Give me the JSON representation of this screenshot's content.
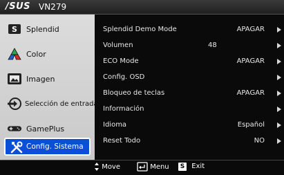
{
  "header": {
    "brand": "/SUS",
    "model": "VN279"
  },
  "sidebar": {
    "items": [
      {
        "label": "Splendid",
        "icon": "splendid-icon"
      },
      {
        "label": "Color",
        "icon": "color-icon"
      },
      {
        "label": "Imagen",
        "icon": "image-icon"
      },
      {
        "label": "Selección de entrada",
        "icon": "input-select-icon"
      },
      {
        "label": "GamePlus",
        "icon": "gameplus-icon"
      },
      {
        "label": "Config. Sistema",
        "icon": "system-setup-icon",
        "active": true
      }
    ]
  },
  "settings": [
    {
      "name": "Splendid Demo Mode",
      "value": "APAGAR"
    },
    {
      "name": "Volumen",
      "value": "48"
    },
    {
      "name": "ECO Mode",
      "value": "APAGAR"
    },
    {
      "name": "Config. OSD",
      "value": ""
    },
    {
      "name": "Bloqueo de teclas",
      "value": "APAGAR"
    },
    {
      "name": "Información",
      "value": ""
    },
    {
      "name": "Idioma",
      "value": "Español"
    },
    {
      "name": "Reset Todo",
      "value": "NO"
    }
  ],
  "footer": {
    "move_label": "Move",
    "menu_label": "Menu",
    "exit_label": "Exit",
    "exit_key": "S"
  },
  "colors": {
    "active_tab": "#0b4fd6",
    "sidebar_bg": "#d4d4d4",
    "pane_bg": "#0a0a0a"
  }
}
